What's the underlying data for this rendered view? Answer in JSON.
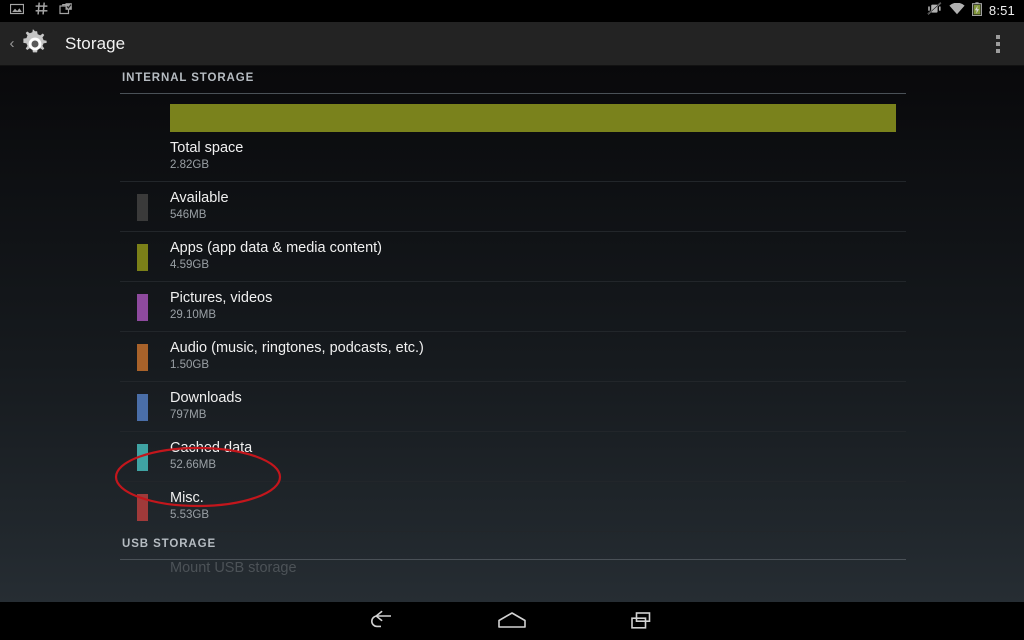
{
  "status_bar": {
    "notification_icons": [
      "screenshot-icon",
      "hash-icon",
      "briefcase-icon"
    ],
    "system_icons": [
      "vibrate-off-icon",
      "wifi-icon",
      "battery-charging-icon"
    ],
    "clock": "8:51"
  },
  "action_bar": {
    "up_icon": "back-chevron-icon",
    "app_icon": "settings-gear-icon",
    "title": "Storage",
    "overflow_icon": "overflow-menu-icon"
  },
  "sections": {
    "internal": {
      "header": "INTERNAL STORAGE",
      "usage_bar": {
        "used_color": "#7a821c",
        "track_color": "#0d0f11",
        "fill_percent": 100
      },
      "items": [
        {
          "title": "Total space",
          "value": "2.82GB",
          "color": null
        },
        {
          "title": "Available",
          "value": "546MB",
          "color": "#3a3a3a"
        },
        {
          "title": "Apps (app data & media content)",
          "value": "4.59GB",
          "color": "#7b8018"
        },
        {
          "title": "Pictures, videos",
          "value": "29.10MB",
          "color": "#8e4a9e"
        },
        {
          "title": "Audio (music, ringtones, podcasts, etc.)",
          "value": "1.50GB",
          "color": "#a8622a"
        },
        {
          "title": "Downloads",
          "value": "797MB",
          "color": "#4a6ea8"
        },
        {
          "title": "Cached data",
          "value": "52.66MB",
          "color": "#3fa3a3"
        },
        {
          "title": "Misc.",
          "value": "5.53GB",
          "color": "#a03a3a"
        }
      ]
    },
    "usb": {
      "header": "USB STORAGE",
      "items": [
        {
          "title": "Mount USB storage"
        }
      ]
    }
  },
  "annotation": {
    "shape": "ellipse",
    "color": "#c3161c",
    "target": "Cached data"
  },
  "nav_bar": {
    "buttons": [
      "back-icon",
      "home-icon",
      "recents-icon"
    ]
  }
}
